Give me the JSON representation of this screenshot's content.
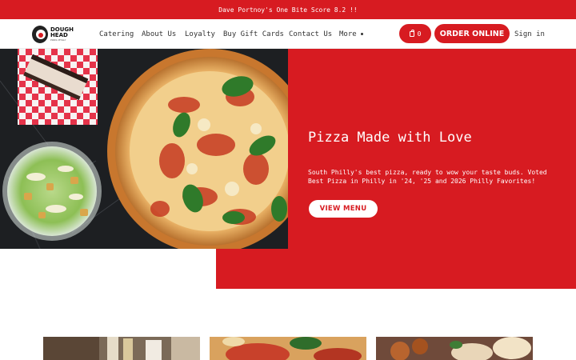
{
  "announcement": "Dave Portnoy's One Bite Score 8.2 !!",
  "brand": {
    "logo_line1": "DOUGH",
    "logo_line2": "HEAD",
    "logo_tagline": "PIZZA PHILLY"
  },
  "nav": {
    "items": [
      {
        "label": "Catering"
      },
      {
        "label": "About Us"
      },
      {
        "label": "Loyalty"
      },
      {
        "label": "Buy Gift Cards"
      },
      {
        "label": "Contact Us"
      },
      {
        "label": "More"
      }
    ],
    "cart_count": "0",
    "order_label": "ORDER ONLINE",
    "signin_label": "Sign in"
  },
  "hero": {
    "title": "Pizza Made with Love",
    "subtitle": "South Philly's best pizza, ready to wow your taste buds. Voted Best Pizza in Philly in '24, '25 and 2026 Philly Favorites!",
    "cta": "VIEW MENU"
  },
  "colors": {
    "brand_red": "#d71b21",
    "white": "#ffffff"
  }
}
